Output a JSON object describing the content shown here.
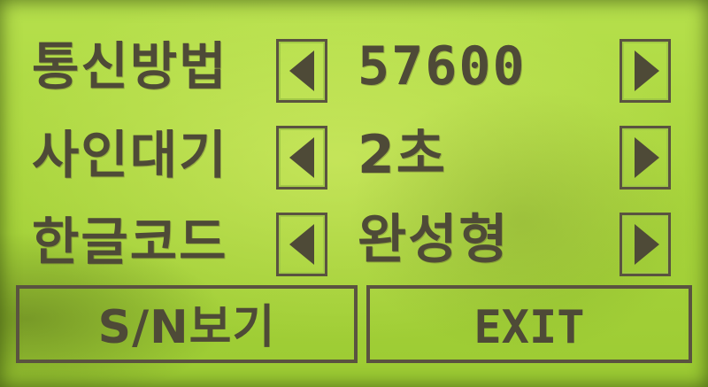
{
  "rows": [
    {
      "label": "통신방법",
      "value": "57600"
    },
    {
      "label": "사인대기",
      "value": "2초"
    },
    {
      "label": "한글코드",
      "value": "완성형"
    }
  ],
  "buttons": {
    "sn_label": "S/N보기",
    "exit_label": "EXIT"
  },
  "colors": {
    "lcd_background": "#a9d53d",
    "pixel_on": "#4e4a37"
  },
  "icons": {
    "left": "left-arrow-icon",
    "right": "right-arrow-icon"
  }
}
